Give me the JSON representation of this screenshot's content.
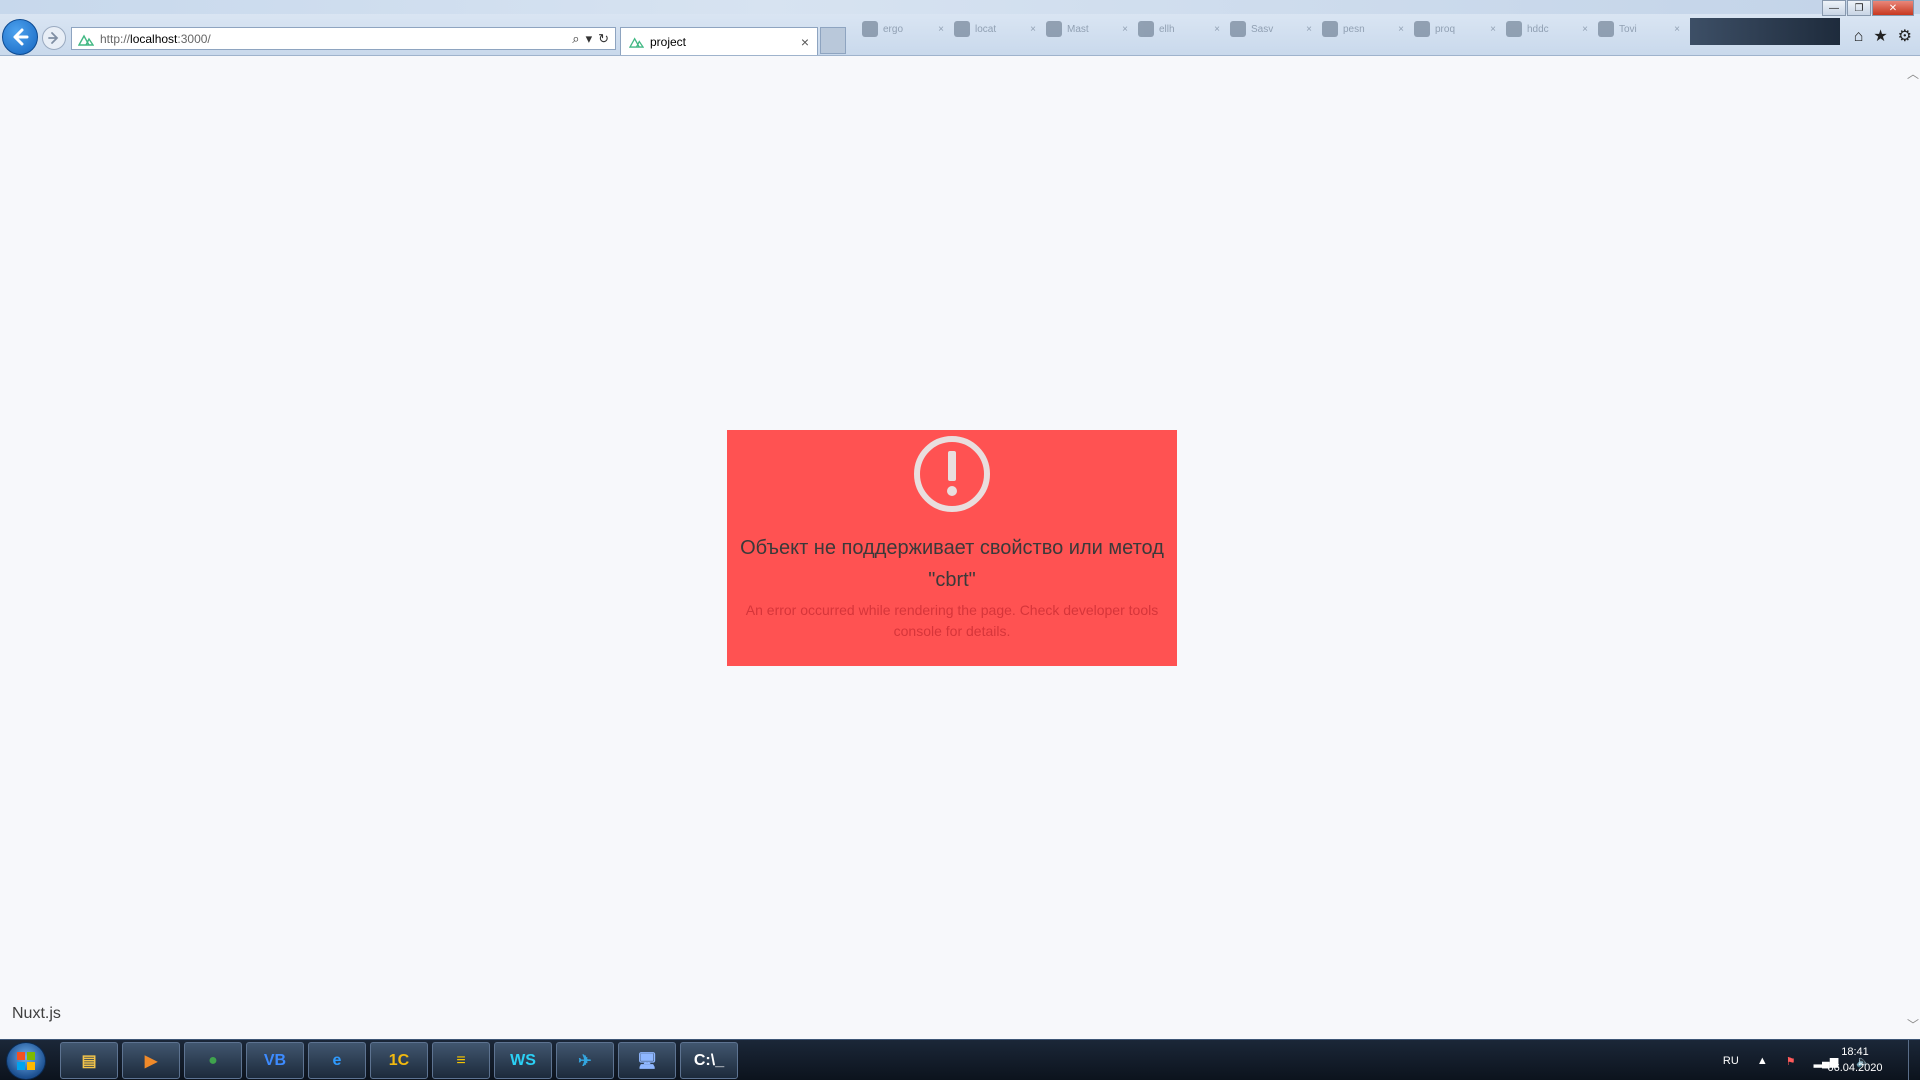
{
  "browser": {
    "url": {
      "protocol": "http://",
      "host": "localhost",
      "rest": ":3000/"
    },
    "active_tab": {
      "title": "project",
      "close_glyph": "×"
    },
    "ghost_tabs": [
      {
        "label": "ergo"
      },
      {
        "label": "locat"
      },
      {
        "label": "Mast"
      },
      {
        "label": "ellh"
      },
      {
        "label": "Sasv"
      },
      {
        "label": "pesn"
      },
      {
        "label": "proq"
      },
      {
        "label": "hddc"
      },
      {
        "label": "Tovi"
      }
    ],
    "window_controls": {
      "minimize": "—",
      "maximize": "❐",
      "close": "✕"
    },
    "chrome_icons": {
      "home": "⌂",
      "favorites": "★",
      "settings": "⚙"
    }
  },
  "page": {
    "error_title": "Объект не поддерживает свойство или метод \"cbrt\"",
    "error_description": "An error occurred while rendering the page. Check developer tools console for details.",
    "footer_link": "Nuxt.js"
  },
  "taskbar": {
    "apps": [
      {
        "name": "file-explorer-icon",
        "glyph": "▤",
        "color": "#f0c24a"
      },
      {
        "name": "media-player-icon",
        "glyph": "▶",
        "color": "#f08a2a"
      },
      {
        "name": "chrome-icon",
        "glyph": "●",
        "color": "#3fa34d"
      },
      {
        "name": "vba-icon",
        "glyph": "VB",
        "color": "#3d8bff"
      },
      {
        "name": "internet-explorer-icon",
        "glyph": "e",
        "color": "#2f9bff"
      },
      {
        "name": "1c-icon",
        "glyph": "1C",
        "color": "#f2b90f"
      },
      {
        "name": "beeline-icon",
        "glyph": "≡",
        "color": "#f5c400"
      },
      {
        "name": "webstorm-icon",
        "glyph": "WS",
        "color": "#2bd0f5"
      },
      {
        "name": "telegram-icon",
        "glyph": "✈",
        "color": "#33a6e0"
      },
      {
        "name": "remote-desktop-icon",
        "glyph": "🖥",
        "color": "#8fb7ff"
      },
      {
        "name": "command-prompt-icon",
        "glyph": "C:\\_",
        "color": "#ffffff"
      }
    ],
    "language": "RU",
    "tray_arrow": "▲",
    "time": "18:41",
    "date": "06.04.2020"
  },
  "colors": {
    "error_bg": "#ff5252",
    "error_title": "#3a3a3a",
    "error_desc": "#d6353a",
    "page_bg": "#f7f8fb",
    "icon_stroke": "#e9dede"
  }
}
